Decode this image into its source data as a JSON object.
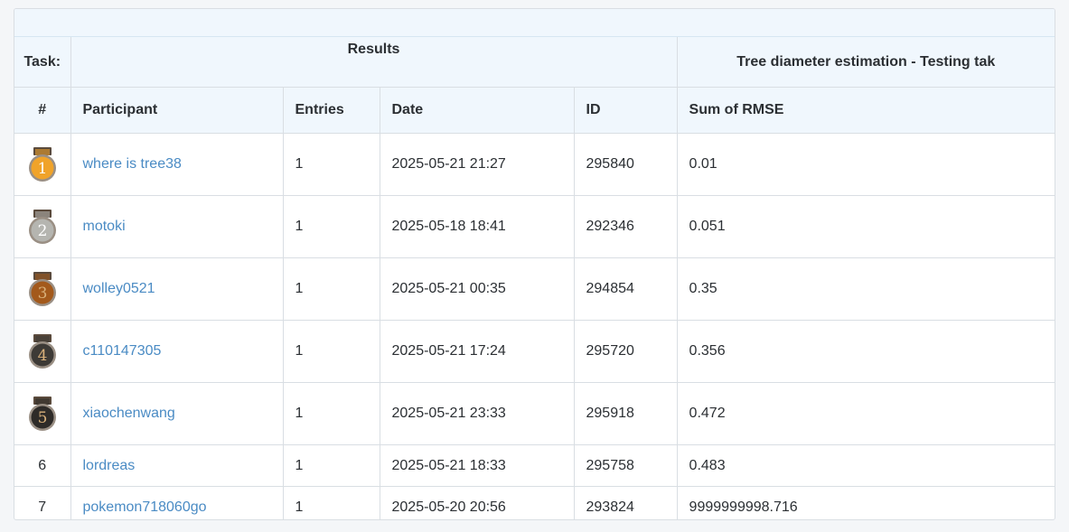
{
  "header": {
    "task_label": "Task:",
    "results_label": "Results",
    "task_name": "Tree diameter estimation - Testing tak"
  },
  "columns": {
    "rank": "#",
    "participant": "Participant",
    "entries": "Entries",
    "date": "Date",
    "id": "ID",
    "score": "Sum of RMSE"
  },
  "medal_colors": {
    "1": "#f0a32a",
    "2": "#b5b5b0",
    "3": "#a3591b",
    "4": "#3d3a36",
    "5": "#2e2b28"
  },
  "rows": [
    {
      "rank": "1",
      "medal": "gold-medal-icon",
      "participant": "where is tree38",
      "entries": "1",
      "date": "2025-05-21 21:27",
      "id": "295840",
      "score": "0.01"
    },
    {
      "rank": "2",
      "medal": "silver-medal-icon",
      "participant": "motoki",
      "entries": "1",
      "date": "2025-05-18 18:41",
      "id": "292346",
      "score": "0.051"
    },
    {
      "rank": "3",
      "medal": "bronze-medal-icon",
      "participant": "wolley0521",
      "entries": "1",
      "date": "2025-05-21 00:35",
      "id": "294854",
      "score": "0.35"
    },
    {
      "rank": "4",
      "medal": "fourth-medal-icon",
      "participant": "c110147305",
      "entries": "1",
      "date": "2025-05-21 17:24",
      "id": "295720",
      "score": "0.356"
    },
    {
      "rank": "5",
      "medal": "fifth-medal-icon",
      "participant": "xiaochenwang",
      "entries": "1",
      "date": "2025-05-21 23:33",
      "id": "295918",
      "score": "0.472"
    },
    {
      "rank": "6",
      "medal": "",
      "participant": "lordreas",
      "entries": "1",
      "date": "2025-05-21 18:33",
      "id": "295758",
      "score": "0.483"
    },
    {
      "rank": "7",
      "medal": "",
      "participant": "pokemon718060go",
      "entries": "1",
      "date": "2025-05-20 20:56",
      "id": "293824",
      "score": "9999999998.716"
    }
  ]
}
